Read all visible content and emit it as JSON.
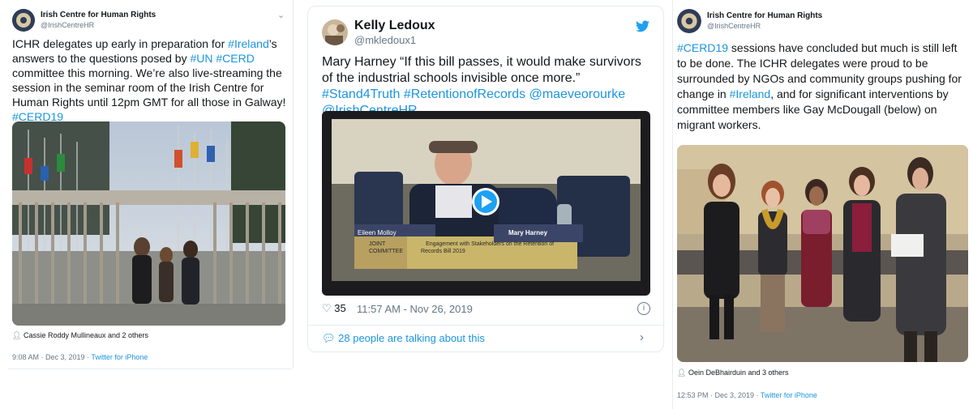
{
  "tweet1": {
    "name": "Irish Centre for Human Rights",
    "handle": "@IrishCentreHR",
    "text": [
      {
        "t": "ICHR delegates up early in preparation for ",
        "tag": false
      },
      {
        "t": "#Ireland",
        "tag": true
      },
      {
        "t": "’s answers to the questions posed by ",
        "tag": false
      },
      {
        "t": "#UN",
        "tag": true
      },
      {
        "t": " ",
        "tag": false
      },
      {
        "t": "#CERD",
        "tag": true
      },
      {
        "t": " committee this morning. We’re also live-streaming the session in the seminar room of the Irish Centre for Human Rights until 12pm GMT for all those in Galway! ",
        "tag": false
      },
      {
        "t": "#CERD19",
        "tag": true
      }
    ],
    "tagged": "Cassie Roddy Mullineaux and 2 others",
    "time": "9:08 AM · Dec 3, 2019 · ",
    "source": "Twitter for iPhone"
  },
  "tweet2": {
    "name": "Kelly Ledoux",
    "handle": "@mkledoux1",
    "text": [
      {
        "t": "Mary Harney “If this bill passes, it would make survivors of the industrial schools invisible once more.” ",
        "tag": false
      },
      {
        "t": "#Stand4Truth",
        "tag": true
      },
      {
        "t": " ",
        "tag": false
      },
      {
        "t": "#RetentionofRecords",
        "tag": true
      },
      {
        "t": " ",
        "tag": false
      },
      {
        "t": "@maeveorourke",
        "tag": true
      },
      {
        "t": " ",
        "tag": false
      },
      {
        "t": "@IrishCentreHR",
        "tag": true
      }
    ],
    "video_label_speaker": "Eileen Molloy",
    "video_label_name": "Mary Harney",
    "video_caption_1": "JOINT",
    "video_caption_2": "COMMITTEE",
    "video_caption_3": "Engagement with Stakeholders on the Retention of",
    "video_caption_4": "Records Bill 2019",
    "likes": "35",
    "time": "11:57 AM - Nov 26, 2019",
    "talking": "28 people are talking about this"
  },
  "tweet3": {
    "name": "Irish Centre for Human Rights",
    "handle": "@IrishCentreHR",
    "text": [
      {
        "t": "#CERD19",
        "tag": true
      },
      {
        "t": " sessions have concluded but much is still left to be done. The ICHR delegates were proud to be surrounded by NGOs and community groups pushing for change in ",
        "tag": false
      },
      {
        "t": "#Ireland",
        "tag": true
      },
      {
        "t": ", and for significant interventions by committee members like Gay McDougall (below) on migrant workers.",
        "tag": false
      }
    ],
    "tagged": "Oein DeBhairduin and 3 others",
    "time": "12:53 PM · Dec 3, 2019 · ",
    "source": "Twitter for iPhone"
  },
  "colors": {
    "link": "#1b95e0",
    "text": "#14171a",
    "muted": "#657786",
    "border": "#e6ecf0"
  }
}
